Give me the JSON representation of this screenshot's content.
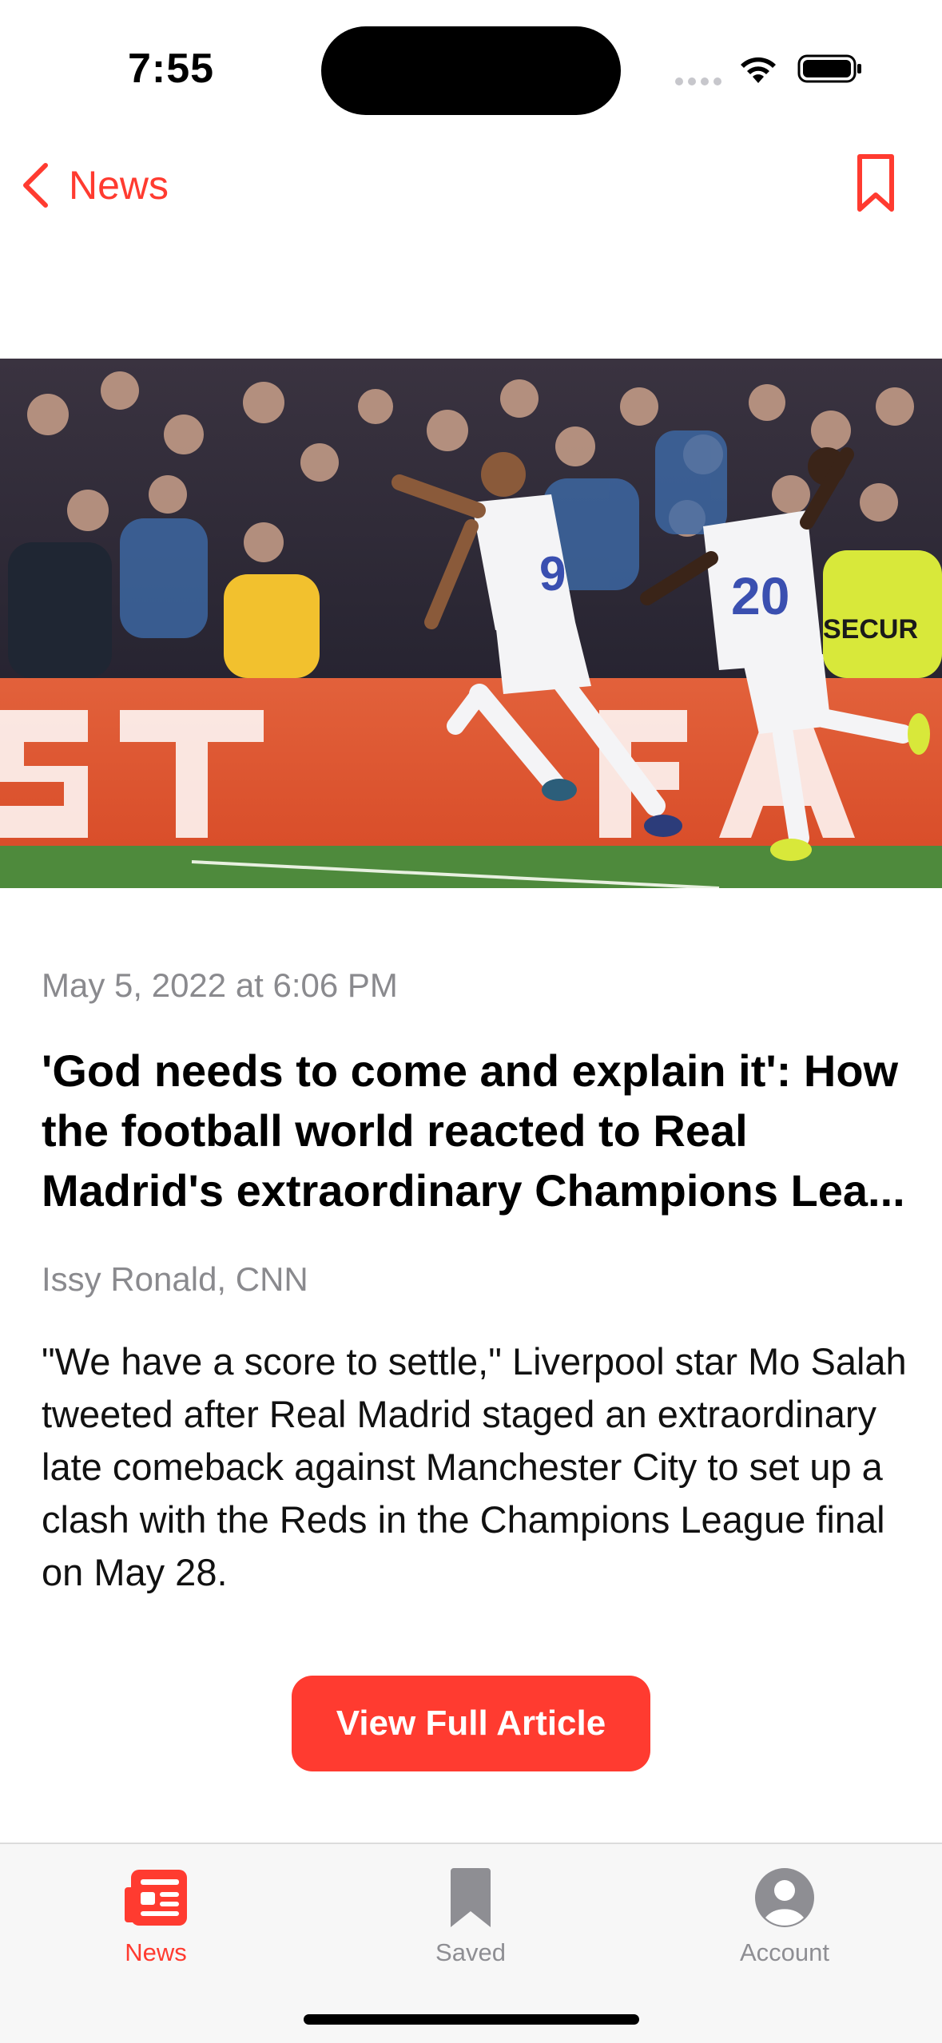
{
  "status": {
    "time": "7:55"
  },
  "nav": {
    "back_label": "News"
  },
  "article": {
    "date": "May 5, 2022 at 6:06 PM",
    "title": "'God needs to come and explain it': How the football world reacted to Real Madrid's extraordinary Champions Lea...",
    "source": "Issy Ronald, CNN",
    "summary": "\"We have a score to settle,\" Liverpool star Mo Salah tweeted after Real Madrid staged an extraordinary late comeback against Manchester City to set up a clash with the Reds in the Champions League final on May 28.",
    "button_label": "View Full Article",
    "image_jersey_numbers": [
      "9",
      "20"
    ],
    "image_board_text": "SECUR"
  },
  "tabs": [
    {
      "label": "News",
      "icon": "newspaper-icon",
      "active": true
    },
    {
      "label": "Saved",
      "icon": "bookmark-icon",
      "active": false
    },
    {
      "label": "Account",
      "icon": "person-circle-icon",
      "active": false
    }
  ],
  "colors": {
    "accent": "#ff3b30",
    "inactive": "#8e8e93",
    "secondary_text": "#8a8a8e"
  }
}
